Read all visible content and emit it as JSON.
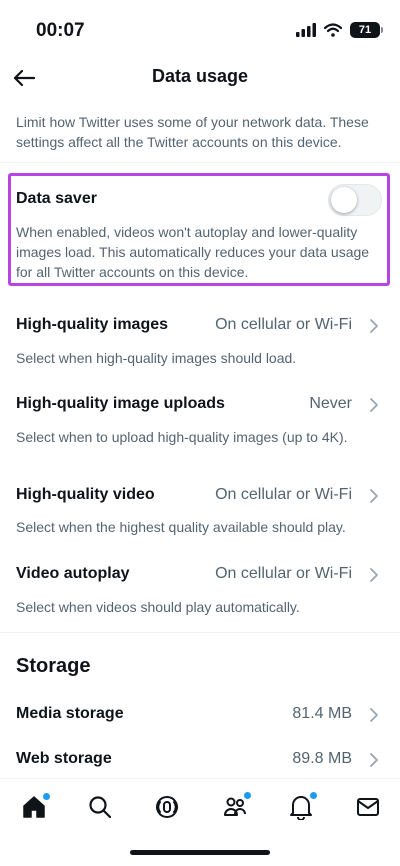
{
  "status": {
    "time": "00:07",
    "battery": "71"
  },
  "header": {
    "title": "Data usage"
  },
  "intro": "Limit how Twitter uses some of your network data. These settings affect all the Twitter accounts on this device.",
  "data_saver": {
    "label": "Data saver",
    "enabled": false,
    "description": "When enabled, videos won't autoplay and lower-quality images load. This automatically reduces your data usage for all Twitter accounts on this device."
  },
  "settings": [
    {
      "label": "High-quality images",
      "value": "On cellular or Wi-Fi",
      "description": "Select when high-quality images should load."
    },
    {
      "label": "High-quality image uploads",
      "value": "Never",
      "description": "Select when to upload high-quality images (up to 4K)."
    },
    {
      "label": "High-quality video",
      "value": "On cellular or Wi-Fi",
      "description": "Select when the highest quality available should play."
    },
    {
      "label": "Video autoplay",
      "value": "On cellular or Wi-Fi",
      "description": "Select when videos should play automatically."
    }
  ],
  "storage": {
    "heading": "Storage",
    "items": [
      {
        "label": "Media storage",
        "value": "81.4 MB"
      },
      {
        "label": "Web storage",
        "value": "89.8 MB"
      }
    ]
  },
  "colors": {
    "accent": "#1d9bf0",
    "highlight": "#b944e6",
    "text": "#0f1419",
    "secondary": "#536471"
  },
  "tabs": [
    "home-icon",
    "search-icon",
    "spaces-icon",
    "communities-icon",
    "notifications-icon",
    "messages-icon"
  ]
}
